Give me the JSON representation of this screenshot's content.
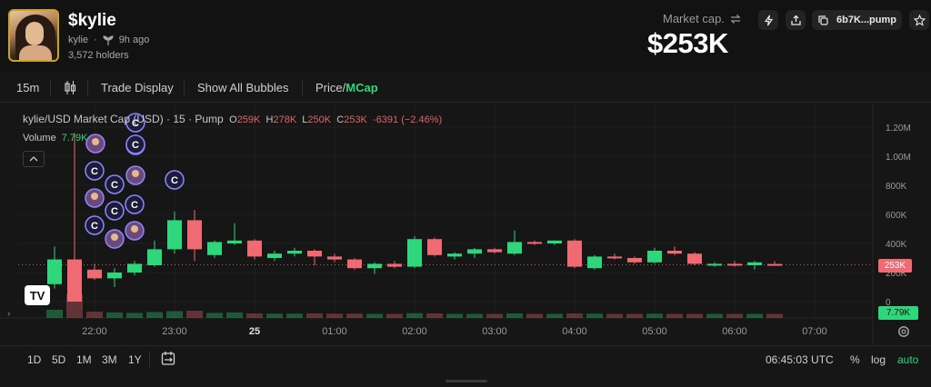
{
  "token": {
    "ticker": "$kylie",
    "creator": "kylie",
    "age": "9h ago",
    "holders": "3,572 holders"
  },
  "market": {
    "label": "Market cap.",
    "value": "$253K"
  },
  "header_buttons": {
    "address": "6b7K...pump"
  },
  "toolbar": {
    "interval": "15m",
    "trade_display": "Trade Display",
    "show_bubbles": "Show All Bubbles",
    "price_label": "Price",
    "mcap_label": "MCap",
    "price_sep": "/"
  },
  "legend": {
    "symbol": "kylie/USD Market Cap (USD) · 15 · Pump",
    "o_label": "O",
    "o_value": "259K",
    "h_label": "H",
    "h_value": "278K",
    "l_label": "L",
    "l_value": "250K",
    "c_label": "C",
    "c_value": "253K",
    "change": "-6391 (−2.46%)",
    "volume_label": "Volume",
    "volume_value": "7.79K"
  },
  "tags": {
    "price": "253K",
    "volume": "7.79K"
  },
  "bottom": {
    "ranges": [
      "1D",
      "5D",
      "1M",
      "3M",
      "1Y"
    ],
    "time": "06:45:03 UTC",
    "percent": "%",
    "log": "log",
    "auto": "auto"
  },
  "colors": {
    "up": "#2fd67b",
    "down": "#f06a73",
    "accent_green": "#2fd67b",
    "background": "#161616"
  },
  "chart_data": {
    "type": "candlestick",
    "y_axis_ticks": [
      "1.20M",
      "1.00M",
      "800K",
      "600K",
      "400K",
      "200K",
      "0"
    ],
    "y_tick_values": [
      1200,
      1000,
      800,
      600,
      400,
      200,
      0
    ],
    "x_axis_ticks": [
      "22:00",
      "23:00",
      "25",
      "01:00",
      "02:00",
      "03:00",
      "04:00",
      "05:00",
      "06:00",
      "07:00"
    ],
    "x_tick_hours": [
      22,
      23,
      24,
      25,
      26,
      27,
      28,
      29,
      30,
      31
    ],
    "ylim": [
      0,
      1300
    ],
    "unit": "K USD",
    "current_price": 253,
    "candles": [
      {
        "t": 21.5,
        "o": 120,
        "h": 380,
        "l": 90,
        "c": 290
      },
      {
        "t": 21.75,
        "o": 290,
        "h": 1160,
        "l": 0,
        "c": 0
      },
      {
        "t": 22.0,
        "o": 220,
        "h": 260,
        "l": 150,
        "c": 160
      },
      {
        "t": 22.25,
        "o": 160,
        "h": 230,
        "l": 100,
        "c": 200
      },
      {
        "t": 22.5,
        "o": 200,
        "h": 280,
        "l": 180,
        "c": 260
      },
      {
        "t": 22.75,
        "o": 250,
        "h": 420,
        "l": 240,
        "c": 360
      },
      {
        "t": 23.0,
        "o": 360,
        "h": 620,
        "l": 330,
        "c": 560
      },
      {
        "t": 23.25,
        "o": 560,
        "h": 630,
        "l": 280,
        "c": 360
      },
      {
        "t": 23.5,
        "o": 320,
        "h": 420,
        "l": 300,
        "c": 410
      },
      {
        "t": 23.75,
        "o": 400,
        "h": 540,
        "l": 390,
        "c": 420
      },
      {
        "t": 24.0,
        "o": 420,
        "h": 430,
        "l": 290,
        "c": 310
      },
      {
        "t": 24.25,
        "o": 300,
        "h": 350,
        "l": 280,
        "c": 330
      },
      {
        "t": 24.5,
        "o": 330,
        "h": 370,
        "l": 310,
        "c": 350
      },
      {
        "t": 24.75,
        "o": 350,
        "h": 360,
        "l": 250,
        "c": 310
      },
      {
        "t": 25.0,
        "o": 310,
        "h": 330,
        "l": 270,
        "c": 290
      },
      {
        "t": 25.25,
        "o": 290,
        "h": 300,
        "l": 220,
        "c": 230
      },
      {
        "t": 25.5,
        "o": 230,
        "h": 270,
        "l": 190,
        "c": 260
      },
      {
        "t": 25.75,
        "o": 260,
        "h": 280,
        "l": 230,
        "c": 240
      },
      {
        "t": 26.0,
        "o": 240,
        "h": 450,
        "l": 230,
        "c": 430
      },
      {
        "t": 26.25,
        "o": 430,
        "h": 440,
        "l": 310,
        "c": 320
      },
      {
        "t": 26.5,
        "o": 310,
        "h": 340,
        "l": 290,
        "c": 330
      },
      {
        "t": 26.75,
        "o": 330,
        "h": 370,
        "l": 300,
        "c": 360
      },
      {
        "t": 27.0,
        "o": 360,
        "h": 370,
        "l": 330,
        "c": 340
      },
      {
        "t": 27.25,
        "o": 330,
        "h": 490,
        "l": 320,
        "c": 410
      },
      {
        "t": 27.5,
        "o": 410,
        "h": 420,
        "l": 390,
        "c": 400
      },
      {
        "t": 27.75,
        "o": 400,
        "h": 420,
        "l": 390,
        "c": 420
      },
      {
        "t": 28.0,
        "o": 420,
        "h": 430,
        "l": 230,
        "c": 240
      },
      {
        "t": 28.25,
        "o": 230,
        "h": 320,
        "l": 220,
        "c": 310
      },
      {
        "t": 28.5,
        "o": 310,
        "h": 330,
        "l": 290,
        "c": 300
      },
      {
        "t": 28.75,
        "o": 300,
        "h": 310,
        "l": 260,
        "c": 270
      },
      {
        "t": 29.0,
        "o": 270,
        "h": 370,
        "l": 260,
        "c": 350
      },
      {
        "t": 29.25,
        "o": 350,
        "h": 380,
        "l": 320,
        "c": 330
      },
      {
        "t": 29.5,
        "o": 330,
        "h": 340,
        "l": 250,
        "c": 260
      },
      {
        "t": 29.75,
        "o": 250,
        "h": 270,
        "l": 240,
        "c": 260
      },
      {
        "t": 30.0,
        "o": 260,
        "h": 280,
        "l": 240,
        "c": 250
      },
      {
        "t": 30.25,
        "o": 250,
        "h": 280,
        "l": 220,
        "c": 270
      },
      {
        "t": 30.5,
        "o": 259,
        "h": 278,
        "l": 250,
        "c": 253
      }
    ],
    "volume": [
      {
        "t": 21.5,
        "v": 20
      },
      {
        "t": 21.75,
        "v": 90
      },
      {
        "t": 22.0,
        "v": 12
      },
      {
        "t": 22.25,
        "v": 8
      },
      {
        "t": 22.5,
        "v": 6
      },
      {
        "t": 22.75,
        "v": 10
      },
      {
        "t": 23.0,
        "v": 14
      },
      {
        "t": 23.25,
        "v": 16
      },
      {
        "t": 23.5,
        "v": 6
      },
      {
        "t": 23.75,
        "v": 8
      },
      {
        "t": 24.0,
        "v": 4
      },
      {
        "t": 24.25,
        "v": 3
      },
      {
        "t": 24.5,
        "v": 3
      },
      {
        "t": 24.75,
        "v": 4
      },
      {
        "t": 25.0,
        "v": 3
      },
      {
        "t": 25.25,
        "v": 3
      },
      {
        "t": 25.5,
        "v": 2
      },
      {
        "t": 25.75,
        "v": 2
      },
      {
        "t": 26.0,
        "v": 5
      },
      {
        "t": 26.25,
        "v": 4
      },
      {
        "t": 26.5,
        "v": 2
      },
      {
        "t": 26.75,
        "v": 2
      },
      {
        "t": 27.0,
        "v": 2
      },
      {
        "t": 27.25,
        "v": 4
      },
      {
        "t": 27.5,
        "v": 2
      },
      {
        "t": 27.75,
        "v": 2
      },
      {
        "t": 28.0,
        "v": 4
      },
      {
        "t": 28.25,
        "v": 3
      },
      {
        "t": 28.5,
        "v": 2
      },
      {
        "t": 28.75,
        "v": 2
      },
      {
        "t": 29.0,
        "v": 3
      },
      {
        "t": 29.25,
        "v": 2
      },
      {
        "t": 29.5,
        "v": 2
      },
      {
        "t": 29.75,
        "v": 2
      },
      {
        "t": 30.0,
        "v": 2
      },
      {
        "t": 30.25,
        "v": 2
      },
      {
        "t": 30.5,
        "v": 2
      }
    ],
    "bubbles": [
      {
        "kind": "avatar"
      },
      {
        "kind": "coin"
      },
      {
        "kind": "coin"
      },
      {
        "kind": "coin"
      },
      {
        "kind": "avatar"
      },
      {
        "kind": "coin"
      },
      {
        "kind": "avatar"
      },
      {
        "kind": "coin"
      },
      {
        "kind": "coin"
      },
      {
        "kind": "coin"
      },
      {
        "kind": "coin"
      },
      {
        "kind": "avatar"
      },
      {
        "kind": "avatar"
      },
      {
        "kind": "coin"
      }
    ],
    "bubble_letter": "C"
  }
}
